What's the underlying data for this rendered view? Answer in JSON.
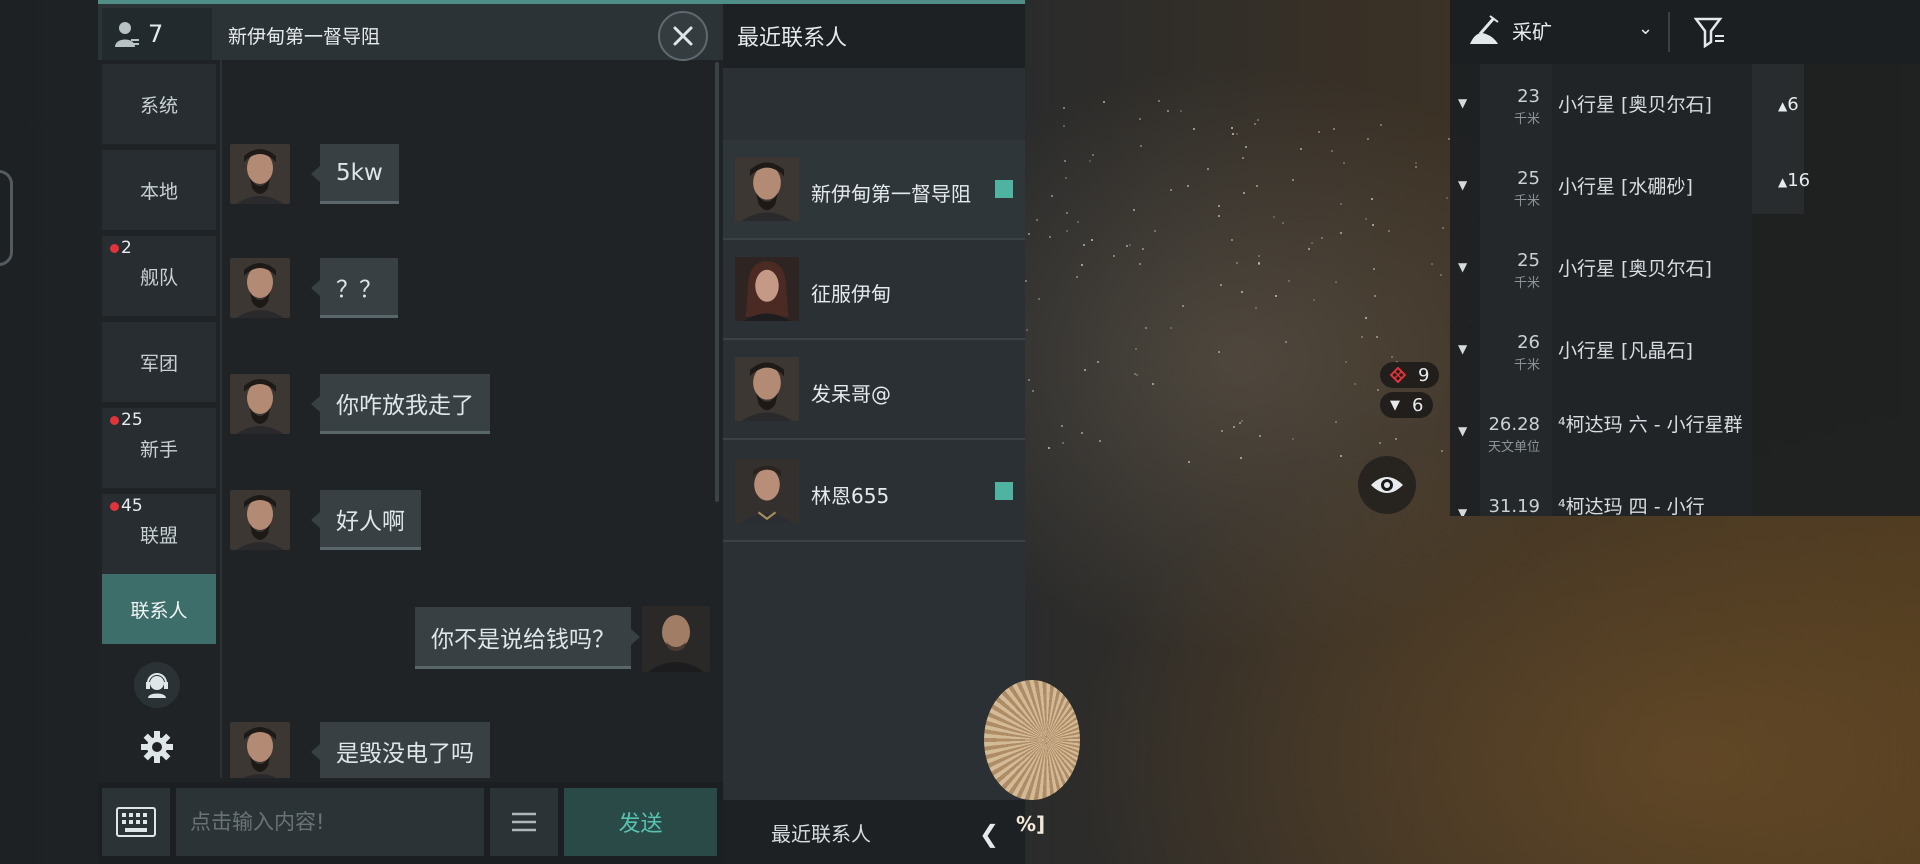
{
  "chat": {
    "member_count": "7",
    "title": "新伊甸第一督导阻",
    "channels": [
      {
        "label": "系统",
        "badge": ""
      },
      {
        "label": "本地",
        "badge": ""
      },
      {
        "label": "舰队",
        "badge": "2"
      },
      {
        "label": "军团",
        "badge": ""
      },
      {
        "label": "新手",
        "badge": "25"
      },
      {
        "label": "联盟",
        "badge": "45"
      },
      {
        "label": "联系人",
        "badge": "",
        "active": true
      }
    ],
    "messages": [
      {
        "side": "left",
        "text": "5kw"
      },
      {
        "side": "left",
        "text": "？？"
      },
      {
        "side": "left",
        "text": "你咋放我走了"
      },
      {
        "side": "left",
        "text": "好人啊"
      },
      {
        "side": "right",
        "text": "你不是说给钱吗？"
      },
      {
        "side": "left",
        "text": "是毁没电了吗"
      }
    ],
    "input_placeholder": "点击输入内容!",
    "send_label": "发送"
  },
  "contacts": {
    "header": "最近联系人",
    "items": [
      {
        "name": "新伊甸第一督导阻",
        "online": true
      },
      {
        "name": "征服伊甸",
        "online": false
      },
      {
        "name": "发呆哥@",
        "online": false
      },
      {
        "name": "林恩655",
        "online": true
      }
    ],
    "footer": "最近联系人"
  },
  "overview": {
    "filter_label": "采矿",
    "rows": [
      {
        "distance": "23",
        "unit": "千米",
        "name": "小行星 [奥贝尔石]"
      },
      {
        "distance": "25",
        "unit": "千米",
        "name": "小行星 [水硼砂]"
      },
      {
        "distance": "25",
        "unit": "千米",
        "name": "小行星 [奥贝尔石]"
      },
      {
        "distance": "26",
        "unit": "千米",
        "name": "小行星 [凡晶石]"
      },
      {
        "distance": "26.28",
        "unit": "天文单位",
        "name": "⁴柯达玛 六 - 小行星群"
      },
      {
        "distance": "31.19",
        "unit": "",
        "name": "⁴柯达玛 四 - 小行"
      }
    ],
    "side_counts": [
      "6",
      "16"
    ]
  },
  "hud": {
    "target_count": "9",
    "asteroid_count": "6",
    "capacitor_suffix": "%]"
  },
  "colors": {
    "accent_teal": "#4f8e87",
    "online_green": "#4fb3a1",
    "badge_red": "#e0333a",
    "send_text": "#58c2b0"
  }
}
